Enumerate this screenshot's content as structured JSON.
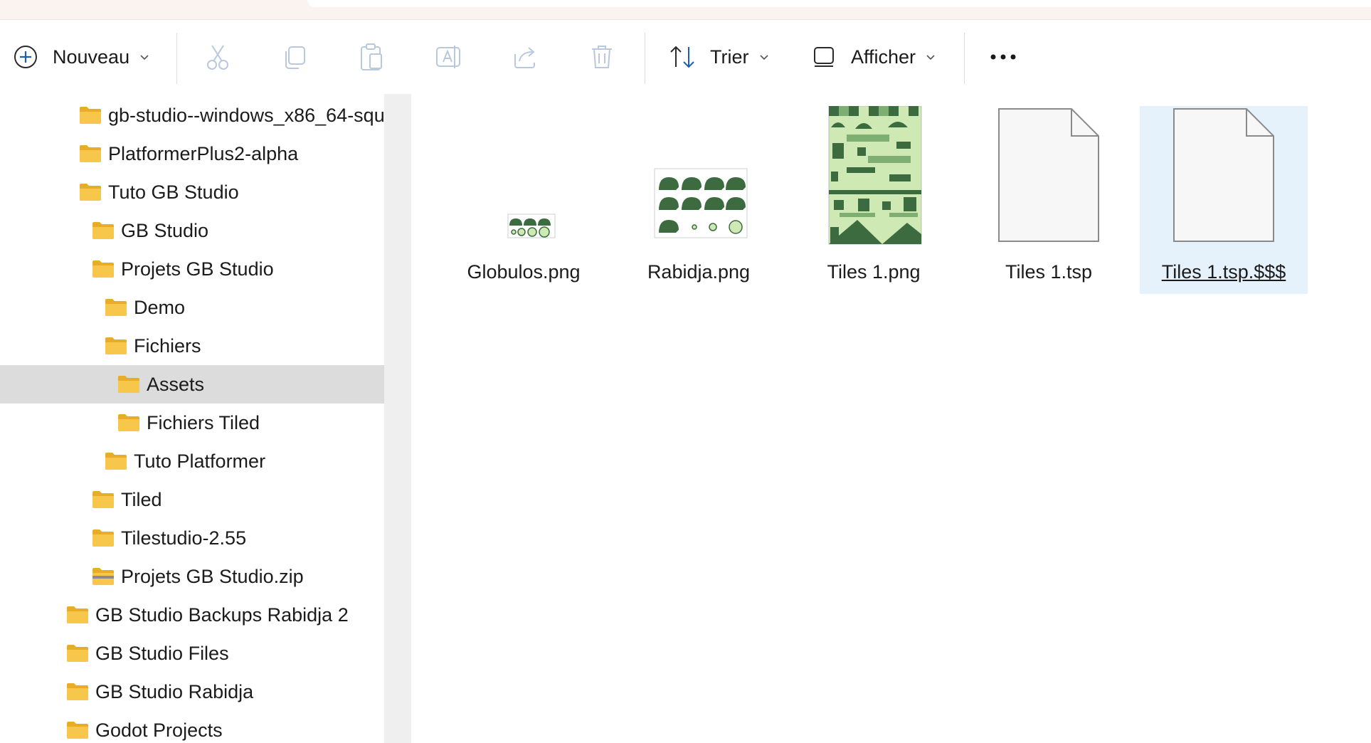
{
  "toolbar": {
    "new_label": "Nouveau",
    "sort_label": "Trier",
    "view_label": "Afficher",
    "icons": [
      "plus-circle-icon",
      "cut-icon",
      "copy-icon",
      "paste-icon",
      "rename-icon",
      "share-icon",
      "delete-icon",
      "sort-icon",
      "view-icon",
      "more-icon"
    ]
  },
  "nav": {
    "items": [
      {
        "label": "gb-studio--windows_x86_64-squ",
        "indent": 2,
        "type": "folder"
      },
      {
        "label": "PlatformerPlus2-alpha",
        "indent": 2,
        "type": "folder"
      },
      {
        "label": "Tuto GB Studio",
        "indent": 2,
        "type": "folder"
      },
      {
        "label": "GB Studio",
        "indent": 3,
        "type": "folder"
      },
      {
        "label": "Projets GB Studio",
        "indent": 3,
        "type": "folder"
      },
      {
        "label": "Demo",
        "indent": 4,
        "type": "folder"
      },
      {
        "label": "Fichiers",
        "indent": 4,
        "type": "folder"
      },
      {
        "label": "Assets",
        "indent": 5,
        "type": "folder",
        "selected": true
      },
      {
        "label": "Fichiers Tiled",
        "indent": 5,
        "type": "folder"
      },
      {
        "label": "Tuto Platformer",
        "indent": 4,
        "type": "folder"
      },
      {
        "label": "Tiled",
        "indent": 3,
        "type": "folder"
      },
      {
        "label": "Tilestudio-2.55",
        "indent": 3,
        "type": "folder"
      },
      {
        "label": "Projets GB Studio.zip",
        "indent": 3,
        "type": "zip"
      },
      {
        "label": "GB Studio Backups Rabidja 2",
        "indent": 1,
        "type": "folder"
      },
      {
        "label": "GB Studio Files",
        "indent": 1,
        "type": "folder"
      },
      {
        "label": "GB Studio Rabidja",
        "indent": 1,
        "type": "folder"
      },
      {
        "label": "Godot Projects",
        "indent": 1,
        "type": "folder"
      }
    ]
  },
  "files": [
    {
      "name": "Globulos.png",
      "kind": "small-sprite"
    },
    {
      "name": "Rabidja.png",
      "kind": "sprite-sheet"
    },
    {
      "name": "Tiles 1.png",
      "kind": "tileset"
    },
    {
      "name": "Tiles 1.tsp",
      "kind": "generic-document"
    },
    {
      "name": "Tiles 1.tsp.$$$",
      "kind": "generic-document",
      "selected": true
    }
  ],
  "colors": {
    "folder": "#f7c74c",
    "folder_dark": "#e8ac28",
    "selection_nav": "#dcdcdc",
    "selection_file": "#e5f1fb",
    "sprite_green": "#3d6b40",
    "tile_light": "#cfe9b4"
  }
}
